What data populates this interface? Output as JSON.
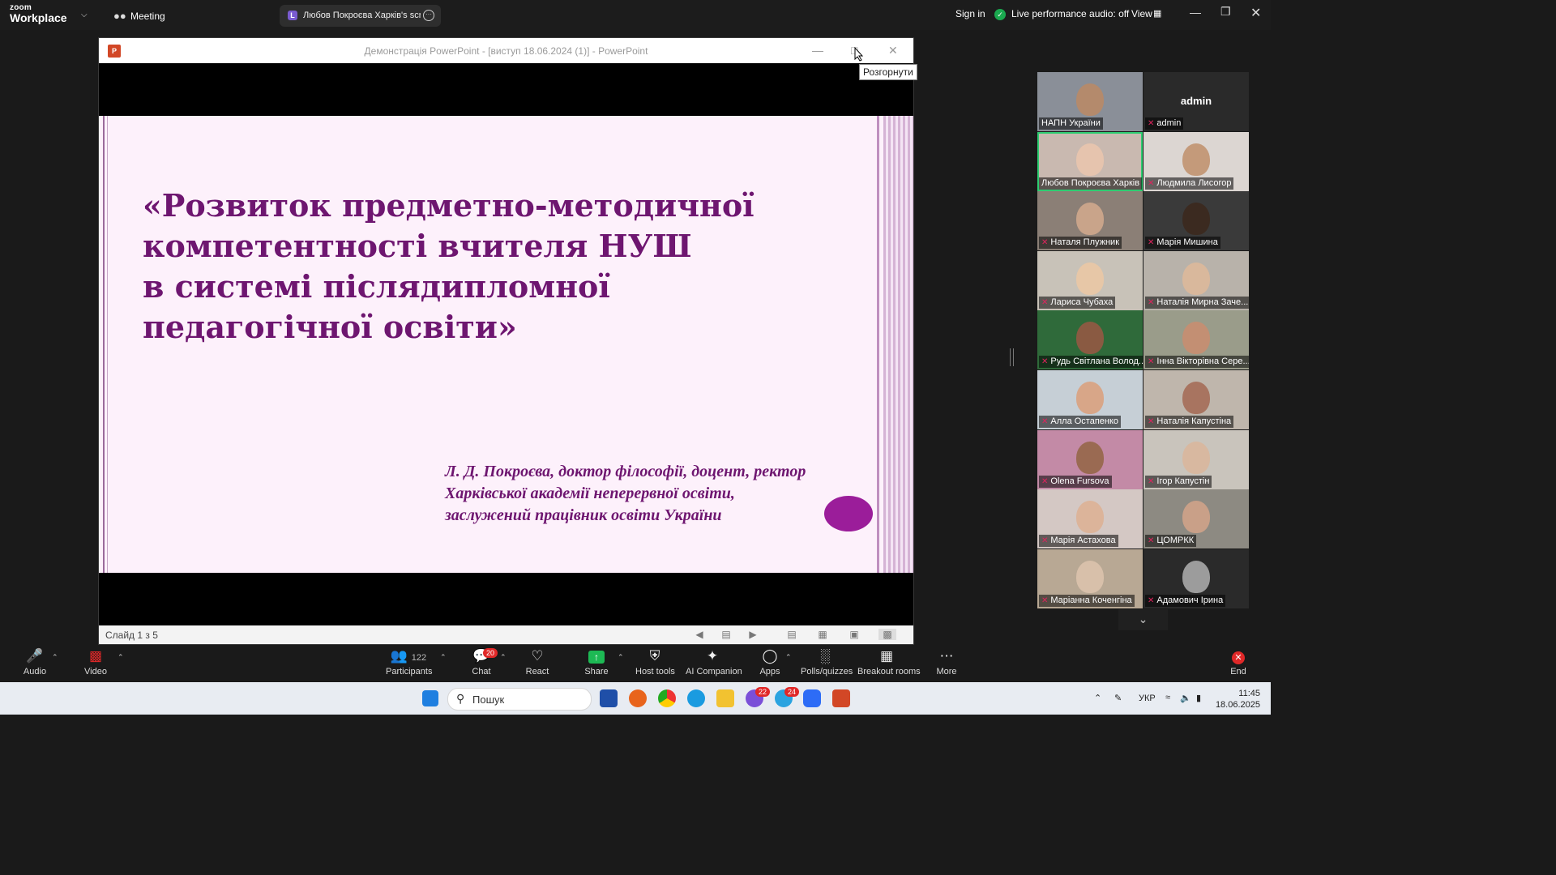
{
  "topbar": {
    "brand_top": "zoom",
    "brand_bottom": "Workplace",
    "meeting_label": "Meeting",
    "tab_initial": "L",
    "tab_title": "Любов Покроєва Харків's screen",
    "sign_in": "Sign in",
    "audio_status": "Live performance audio: off",
    "view_label": "View"
  },
  "powerpoint": {
    "icon_text": "P",
    "window_title": "Демонстрація PowerPoint - [виступ 18.06.2024 (1)] - PowerPoint",
    "tooltip": "Розгорнути",
    "slide_counter": "Слайд 1 з 5",
    "slide": {
      "title_lines": [
        "«Розвиток предметно-методичної",
        "компетентності вчителя НУШ",
        "в системі післядипломної",
        "педагогічної освіти»"
      ],
      "author_lines": [
        "Л. Д. Покроєва, доктор філософії, доцент, ректор",
        "Харківської академії неперервної освіти,",
        "заслужений працівник освіти України"
      ]
    }
  },
  "gallery": {
    "top_right_name": "admin",
    "tiles": [
      {
        "name": "НАПН України",
        "muted": false
      },
      {
        "name": "admin",
        "muted": true
      },
      {
        "name": "Любов Покроєва Харків",
        "muted": false
      },
      {
        "name": "Людмила Лисогор",
        "muted": true
      },
      {
        "name": "Наталя Плужник",
        "muted": true
      },
      {
        "name": "Марія Мишина",
        "muted": true
      },
      {
        "name": "Лариса Чубаха",
        "muted": true
      },
      {
        "name": "Наталія Мирна Заче...",
        "muted": true
      },
      {
        "name": "Рудь Світлана Волод...",
        "muted": true
      },
      {
        "name": "Інна Вікторівна Сере...",
        "muted": true
      },
      {
        "name": "Алла Остапенко",
        "muted": true
      },
      {
        "name": "Наталія Капустіна",
        "muted": true
      },
      {
        "name": "Olena Fursova",
        "muted": true
      },
      {
        "name": "Ігор Капустін",
        "muted": true
      },
      {
        "name": "Марія Астахова",
        "muted": true
      },
      {
        "name": "ЦОМРКК",
        "muted": true
      },
      {
        "name": "Маріанна Коченгіна",
        "muted": true
      },
      {
        "name": "Адамович Ірина",
        "muted": true
      }
    ]
  },
  "toolbar": {
    "audio": "Audio",
    "video": "Video",
    "participants": "Participants",
    "participants_count": "122",
    "chat": "Chat",
    "chat_badge": "20",
    "react": "React",
    "share": "Share",
    "host_tools": "Host tools",
    "ai_companion": "AI Companion",
    "apps": "Apps",
    "polls": "Polls/quizzes",
    "breakout": "Breakout rooms",
    "more": "More",
    "end": "End"
  },
  "taskbar": {
    "search_placeholder": "Пошук",
    "viber_badge": "22",
    "telegram_badge": "24",
    "lang": "УКР",
    "time": "11:45",
    "date": "18.06.2025"
  },
  "colors": {
    "slide_text": "#6e1670",
    "slide_bg": "#fdf1fb",
    "share_green": "#1db954",
    "end_red": "#e02828"
  }
}
